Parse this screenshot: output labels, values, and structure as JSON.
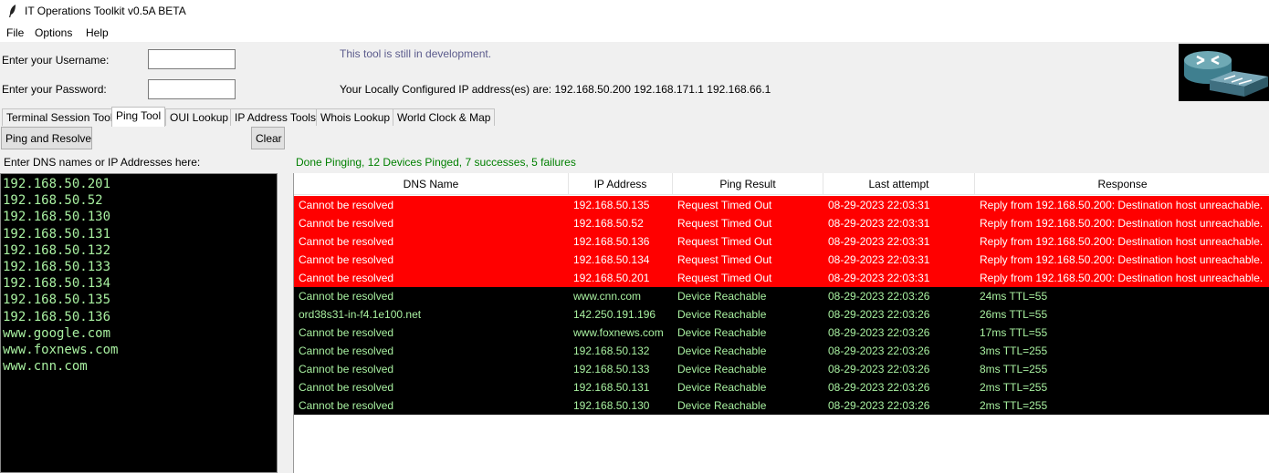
{
  "window": {
    "title": "IT Operations Toolkit v0.5A BETA",
    "icon": "feather-icon"
  },
  "menu": [
    "File",
    "Options",
    "Help"
  ],
  "login": {
    "username_label": "Enter your Username:",
    "password_label": "Enter your Password:",
    "username_value": "",
    "password_value": ""
  },
  "notice": "This tool is still in development.",
  "ip_info": "Your Locally Configured IP address(es) are: 192.168.50.200 192.168.171.1 192.168.66.1",
  "tabs": [
    "Terminal Session Tool",
    "Ping Tool",
    "OUI Lookup",
    "IP Address Tools",
    "Whois Lookup",
    "World Clock & Map"
  ],
  "active_tab": "Ping Tool",
  "buttons": {
    "ping": "Ping and Resolve",
    "clear": "Clear"
  },
  "input_label": "Enter DNS names or IP Addresses here:",
  "status": "Done Pinging, 12 Devices Pinged, 7 successes, 5 failures",
  "input_lines": [
    "192.168.50.201",
    "192.168.50.52",
    "192.168.50.130",
    "192.168.50.131",
    "192.168.50.132",
    "192.168.50.133",
    "192.168.50.134",
    "192.168.50.135",
    "192.168.50.136",
    "www.google.com",
    "www.foxnews.com",
    "www.cnn.com"
  ],
  "table": {
    "columns": [
      "DNS Name",
      "IP Address",
      "Ping Result",
      "Last attempt",
      "Response"
    ],
    "rows": [
      {
        "status": "fail",
        "cells": [
          "Cannot be resolved",
          "192.168.50.135",
          "Request Timed Out",
          "08-29-2023 22:03:31",
          "Reply from 192.168.50.200: Destination host unreachable."
        ]
      },
      {
        "status": "fail",
        "cells": [
          "Cannot be resolved",
          "192.168.50.52",
          "Request Timed Out",
          "08-29-2023 22:03:31",
          "Reply from 192.168.50.200: Destination host unreachable."
        ]
      },
      {
        "status": "fail",
        "cells": [
          "Cannot be resolved",
          "192.168.50.136",
          "Request Timed Out",
          "08-29-2023 22:03:31",
          "Reply from 192.168.50.200: Destination host unreachable."
        ]
      },
      {
        "status": "fail",
        "cells": [
          "Cannot be resolved",
          "192.168.50.134",
          "Request Timed Out",
          "08-29-2023 22:03:31",
          "Reply from 192.168.50.200: Destination host unreachable."
        ]
      },
      {
        "status": "fail",
        "cells": [
          "Cannot be resolved",
          "192.168.50.201",
          "Request Timed Out",
          "08-29-2023 22:03:31",
          "Reply from 192.168.50.200: Destination host unreachable."
        ]
      },
      {
        "status": "ok",
        "cells": [
          "Cannot be resolved",
          "www.cnn.com",
          "Device Reachable",
          "08-29-2023 22:03:26",
          "24ms TTL=55"
        ]
      },
      {
        "status": "ok",
        "cells": [
          "ord38s31-in-f4.1e100.net",
          "142.250.191.196",
          "Device Reachable",
          "08-29-2023 22:03:26",
          "26ms TTL=55"
        ]
      },
      {
        "status": "ok",
        "cells": [
          "Cannot be resolved",
          "www.foxnews.com",
          "Device Reachable",
          "08-29-2023 22:03:26",
          "17ms TTL=55"
        ]
      },
      {
        "status": "ok",
        "cells": [
          "Cannot be resolved",
          "192.168.50.132",
          "Device Reachable",
          "08-29-2023 22:03:26",
          "3ms TTL=255"
        ]
      },
      {
        "status": "ok",
        "cells": [
          "Cannot be resolved",
          "192.168.50.133",
          "Device Reachable",
          "08-29-2023 22:03:26",
          "8ms TTL=255"
        ]
      },
      {
        "status": "ok",
        "cells": [
          "Cannot be resolved",
          "192.168.50.131",
          "Device Reachable",
          "08-29-2023 22:03:26",
          "2ms TTL=255"
        ]
      },
      {
        "status": "ok",
        "cells": [
          "Cannot be resolved",
          "192.168.50.130",
          "Device Reachable",
          "08-29-2023 22:03:26",
          "2ms TTL=255"
        ]
      }
    ]
  },
  "colors": {
    "fail_row": "#ff0000",
    "ok_row": "#000000",
    "ok_text": "#a8f0a0",
    "status_text": "#008000"
  }
}
